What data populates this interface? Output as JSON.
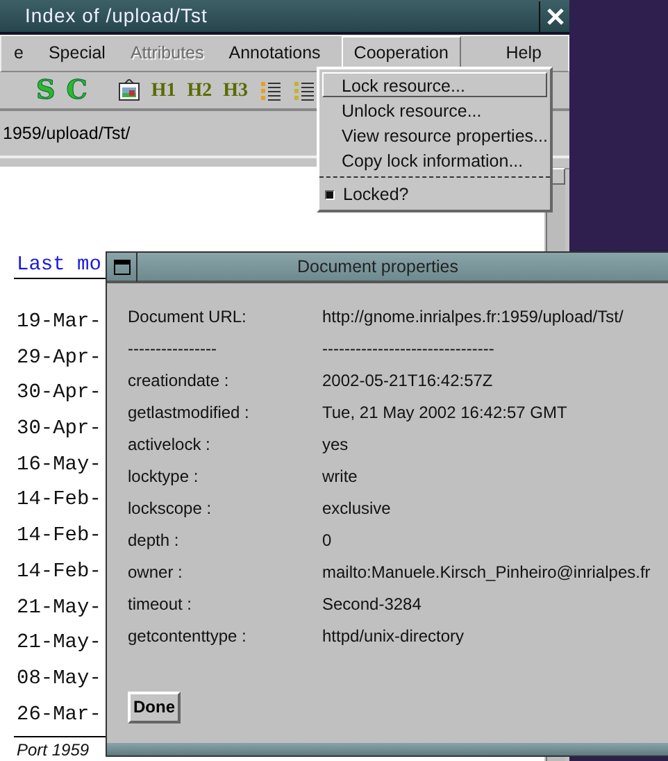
{
  "main_window": {
    "title": "Index of /upload/Tst",
    "menus": [
      {
        "label": "e",
        "disabled": false,
        "selected": false
      },
      {
        "label": "Special",
        "disabled": false,
        "selected": false
      },
      {
        "label": "Attributes",
        "disabled": true,
        "selected": false
      },
      {
        "label": "Annotations",
        "disabled": false,
        "selected": false
      },
      {
        "label": "Cooperation",
        "disabled": false,
        "selected": true
      },
      {
        "label": "Help",
        "disabled": false,
        "selected": false
      }
    ],
    "toolbar": [
      {
        "kind": "letter",
        "label": "S"
      },
      {
        "kind": "letter",
        "label": "C"
      },
      {
        "kind": "image"
      },
      {
        "kind": "heading",
        "label": "H1"
      },
      {
        "kind": "heading",
        "label": "H2"
      },
      {
        "kind": "heading",
        "label": "H3"
      },
      {
        "kind": "bullets"
      },
      {
        "kind": "numbers"
      }
    ],
    "url": "1959/upload/Tst/",
    "heading": "Last mo",
    "dates": [
      "19-Mar-",
      "29-Apr-",
      "30-Apr-",
      "30-Apr-",
      "16-May-",
      "14-Feb-",
      "14-Feb-",
      "14-Feb-",
      "21-May-",
      "21-May-",
      "08-May-",
      "26-Mar-"
    ],
    "footer": "Port 1959"
  },
  "dropdown": {
    "items": [
      {
        "kind": "command",
        "label": "Lock resource...",
        "selected": true
      },
      {
        "kind": "command",
        "label": "Unlock resource...",
        "selected": false
      },
      {
        "kind": "command",
        "label": "View resource properties...",
        "selected": false
      },
      {
        "kind": "command",
        "label": "Copy lock information...",
        "selected": false
      },
      {
        "kind": "separator"
      },
      {
        "kind": "check",
        "label": "Locked?",
        "checked": true
      }
    ]
  },
  "dialog": {
    "title": "Document properties",
    "rows": [
      {
        "label": "Document URL:",
        "value": "http://gnome.inrialpes.fr:1959/upload/Tst/"
      },
      {
        "label": "----------------",
        "value": "-------------------------------"
      },
      {
        "label": "creationdate :",
        "value": "2002-05-21T16:42:57Z"
      },
      {
        "label": "getlastmodified :",
        "value": "Tue, 21 May 2002 16:42:57 GMT"
      },
      {
        "label": "activelock :",
        "value": "yes"
      },
      {
        "label": "locktype :",
        "value": "write"
      },
      {
        "label": "lockscope :",
        "value": "exclusive"
      },
      {
        "label": "depth :",
        "value": "0"
      },
      {
        "label": "owner :",
        "value": "mailto:Manuele.Kirsch_Pinheiro@inrialpes.fr"
      },
      {
        "label": "timeout :",
        "value": "Second-3284"
      },
      {
        "label": "getcontenttype :",
        "value": "httpd/unix-directory"
      }
    ],
    "button": "Done"
  }
}
